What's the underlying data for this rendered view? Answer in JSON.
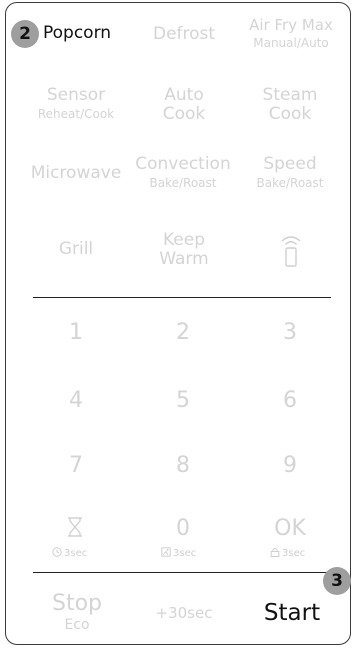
{
  "badges": {
    "step_popcorn": "2",
    "step_start": "3"
  },
  "functions": {
    "popcorn": "Popcorn",
    "defrost": "Defrost",
    "air_fry_max": {
      "main": "Air Fry Max",
      "sub": "Manual/Auto"
    },
    "sensor": {
      "main": "Sensor",
      "sub": "Reheat/Cook"
    },
    "auto_cook": {
      "line1": "Auto",
      "line2": "Cook"
    },
    "steam_cook": {
      "line1": "Steam",
      "line2": "Cook"
    },
    "microwave": "Microwave",
    "convection": {
      "main": "Convection",
      "sub": "Bake/Roast"
    },
    "speed": {
      "main": "Speed",
      "sub": "Bake/Roast"
    },
    "grill": "Grill",
    "keep_warm": {
      "line1": "Keep",
      "line2": "Warm"
    },
    "wifi_icon": "wifi-signal-icon"
  },
  "keypad": {
    "digits": [
      "1",
      "2",
      "3",
      "4",
      "5",
      "6",
      "7",
      "8",
      "9"
    ],
    "zero": "0",
    "ok": "OK",
    "timer_icon": "hourglass-icon",
    "timer_hint": "3sec",
    "zero_hint": "3sec",
    "ok_hint": "3sec",
    "timer_hint_icon": "clock-icon",
    "zero_hint_icon": "child-lock-icon",
    "ok_hint_icon": "lock-icon"
  },
  "bottom": {
    "stop": "Stop",
    "eco": "Eco",
    "plus30": "+30sec",
    "start": "Start"
  },
  "colors": {
    "inactive_text": "#d4d4d4",
    "active_text": "#111111",
    "badge": "#9e9e9e",
    "outline": "#3a3a3a"
  }
}
